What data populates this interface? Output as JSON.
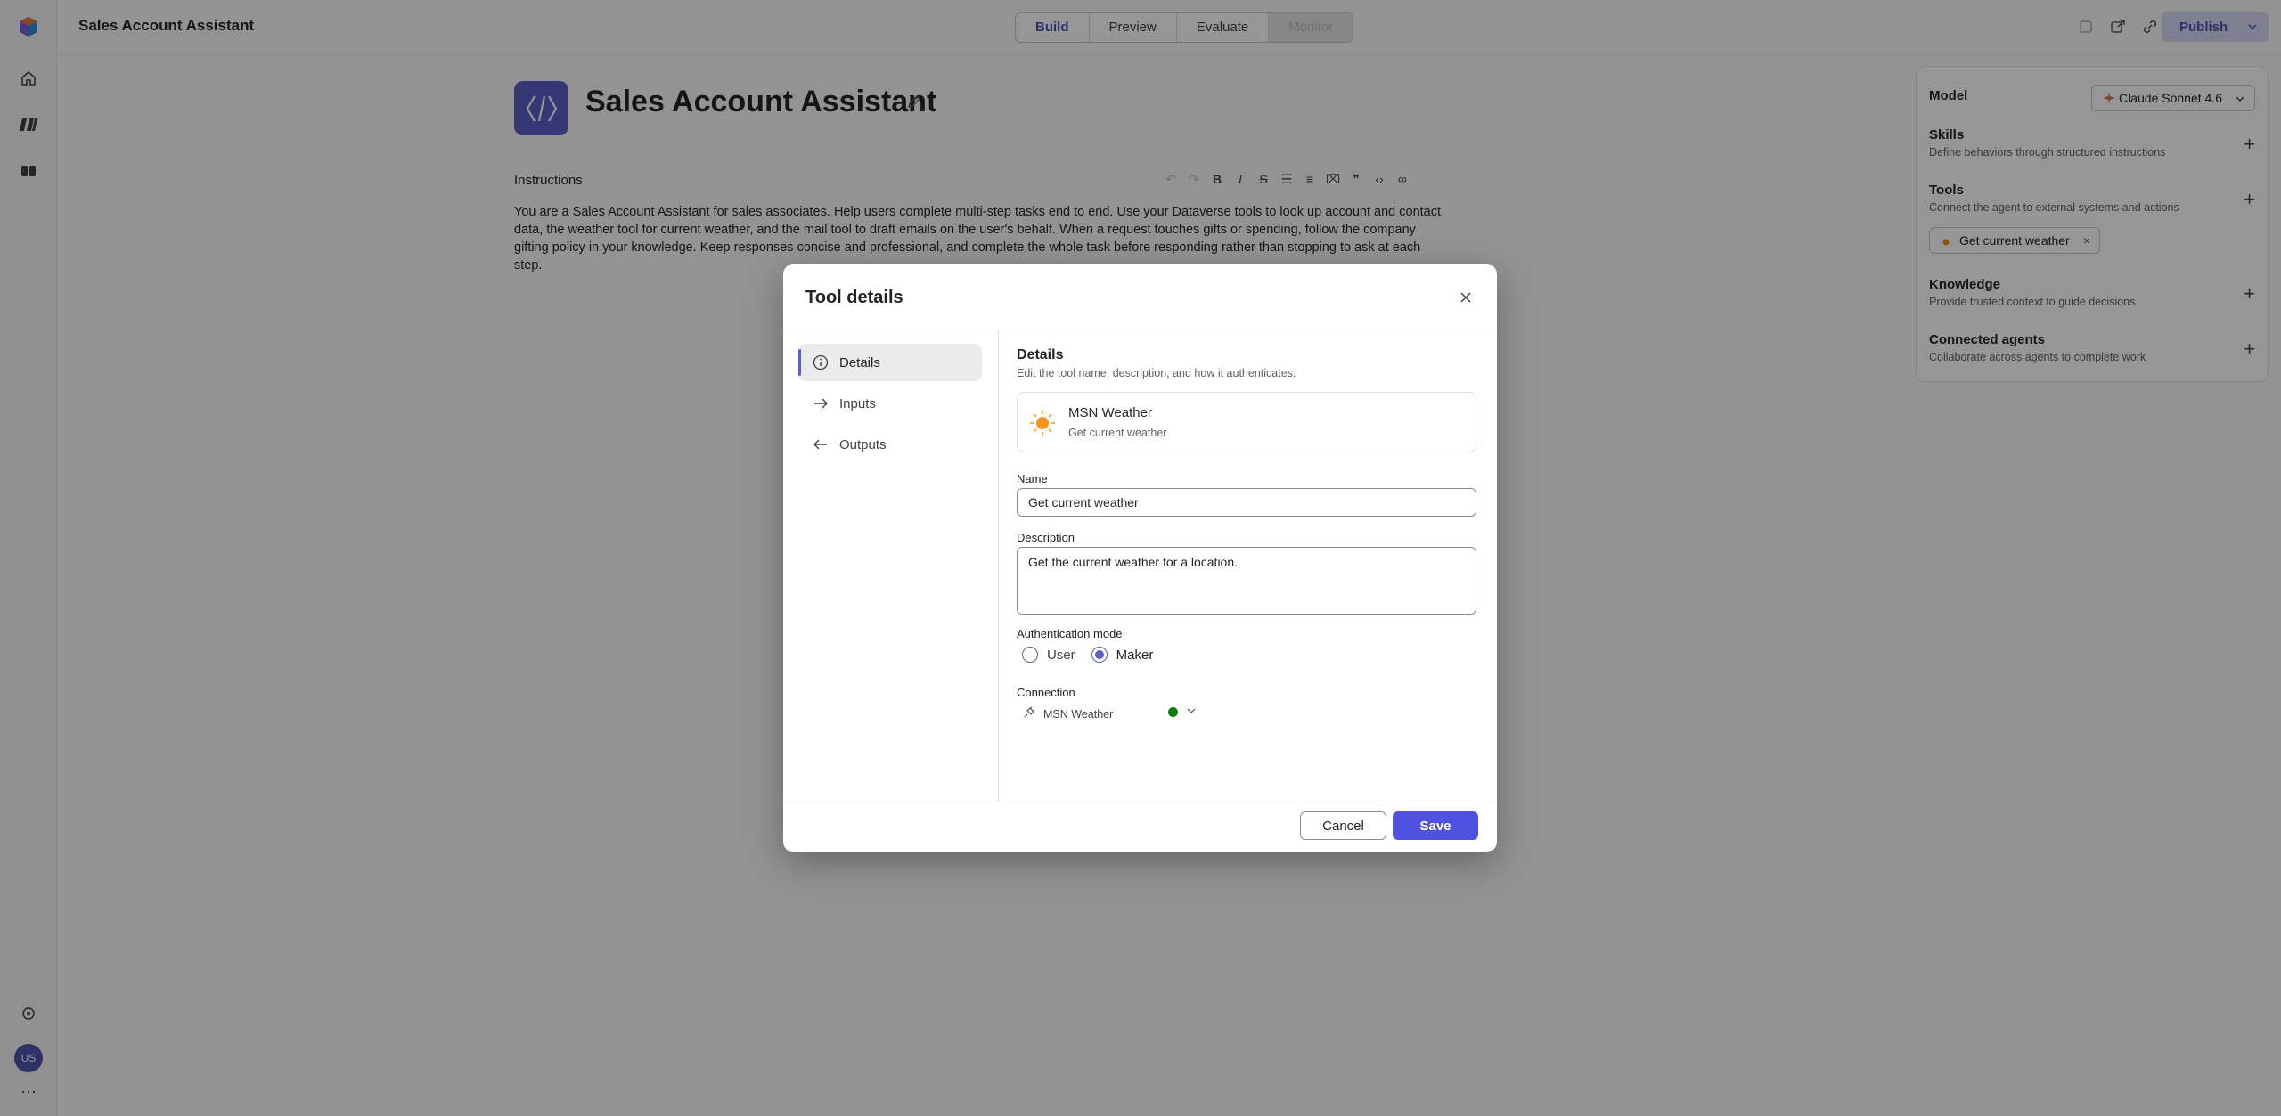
{
  "app": {
    "title": "Sales Account Assistant"
  },
  "header": {
    "tabs": [
      {
        "label": "Build"
      },
      {
        "label": "Preview"
      },
      {
        "label": "Evaluate"
      },
      {
        "label": "Monitor"
      }
    ],
    "publish_label": "Publish"
  },
  "agent": {
    "name": "Sales Account Assistant",
    "instructions_label": "Instructions",
    "instructions_text": "You are a Sales Account Assistant for sales associates. Help users complete multi-step tasks end to end. Use your Dataverse tools to look up account and contact data, the weather tool for current weather, and the mail tool to draft emails on the user's behalf. When a request touches gifts or spending, follow the company gifting policy in your knowledge. Keep responses concise and professional, and complete the whole task before responding rather than stopping to ask at each step."
  },
  "side_panel": {
    "model_label": "Model",
    "model_value": "Claude Sonnet 4.6",
    "sections": [
      {
        "title": "Skills",
        "subtitle": "Define behaviors through structured instructions"
      },
      {
        "title": "Tools",
        "subtitle": "Connect the agent to external systems and actions"
      },
      {
        "title": "Knowledge",
        "subtitle": "Provide trusted context to guide decisions"
      },
      {
        "title": "Connected agents",
        "subtitle": "Collaborate across agents to complete work"
      }
    ],
    "tool_chip": "Get current weather"
  },
  "user": {
    "initials": "US"
  },
  "dialog": {
    "title": "Tool details",
    "nav": [
      {
        "label": "Details"
      },
      {
        "label": "Inputs"
      },
      {
        "label": "Outputs"
      }
    ],
    "section_title": "Details",
    "section_subtitle": "Edit the tool name, description, and how it authenticates.",
    "connector": {
      "name": "MSN Weather",
      "action": "Get current weather"
    },
    "name_label": "Name",
    "name_value": "Get current weather",
    "description_label": "Description",
    "description_value": "Get the current weather for a location.",
    "auth_label": "Authentication mode",
    "auth_options": [
      {
        "label": "User",
        "selected": false
      },
      {
        "label": "Maker",
        "selected": true
      }
    ],
    "connection_label": "Connection",
    "connection_value": "MSN Weather",
    "cancel_label": "Cancel",
    "save_label": "Save"
  },
  "colors": {
    "accent": "#4f52e0",
    "brand": "#5b5fc7",
    "status_ok": "#107c10",
    "overlay": "rgba(0,0,0,0.41)"
  }
}
